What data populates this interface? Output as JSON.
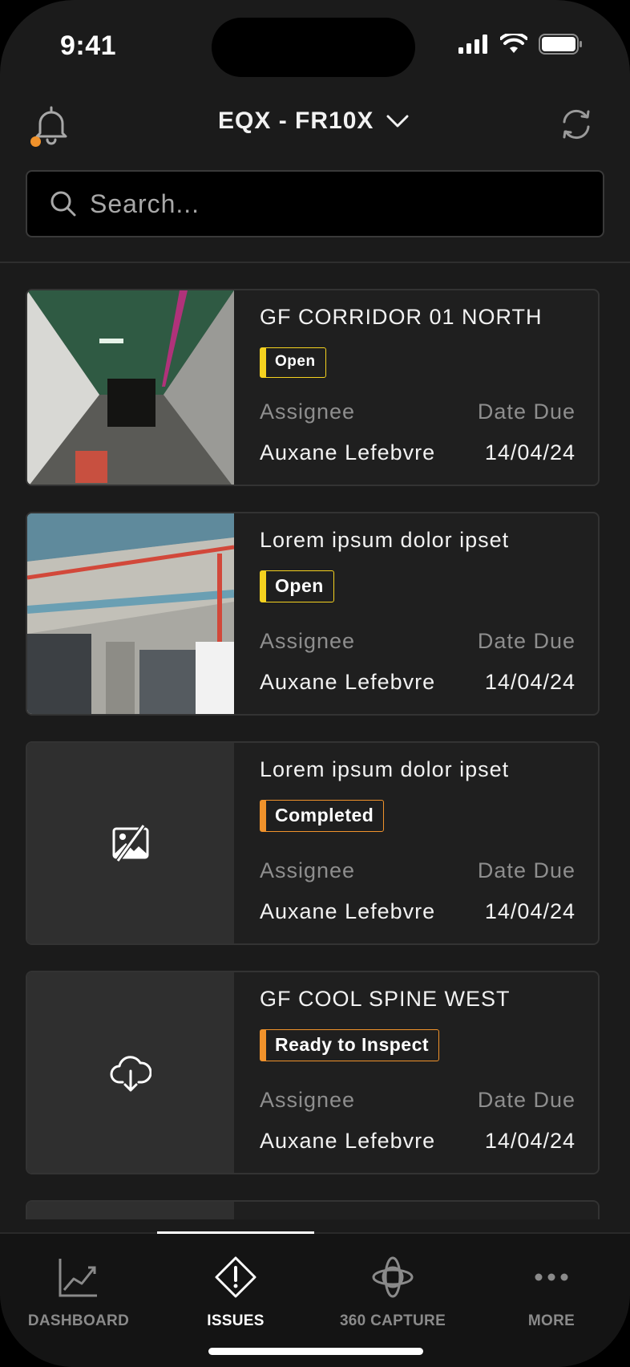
{
  "status_bar": {
    "time": "9:41"
  },
  "header": {
    "project_title": "EQX - FR10X"
  },
  "search": {
    "placeholder": "Search..."
  },
  "issues": [
    {
      "title": "GF CORRIDOR 01 NORTH",
      "status": "Open",
      "assignee_label": "Assignee",
      "assignee": "Auxane Lefebvre",
      "due_label": "Date Due",
      "due": "14/04/24",
      "thumbnail": "photo"
    },
    {
      "title": "Lorem ipsum dolor ipset",
      "status": "Open",
      "assignee_label": "Assignee",
      "assignee": "Auxane Lefebvre",
      "due_label": "Date Due",
      "due": "14/04/24",
      "thumbnail": "photo"
    },
    {
      "title": "Lorem ipsum dolor ipset",
      "status": "Completed",
      "assignee_label": "Assignee",
      "assignee": "Auxane Lefebvre",
      "due_label": "Date Due",
      "due": "14/04/24",
      "thumbnail": "image-unavailable-icon"
    },
    {
      "title": "GF COOL SPINE WEST",
      "status": "Ready to Inspect",
      "assignee_label": "Assignee",
      "assignee": "Auxane Lefebvre",
      "due_label": "Date Due",
      "due": "14/04/24",
      "thumbnail": "cloud-download-icon"
    }
  ],
  "colors": {
    "open": "#f5d21f",
    "completed": "#f0922b",
    "notification": "#f0922b"
  },
  "tabbar": {
    "tabs": [
      {
        "label": "DASHBOARD",
        "icon": "chart-icon"
      },
      {
        "label": "ISSUES",
        "icon": "warning-diamond-icon",
        "active": true
      },
      {
        "label": "360 CAPTURE",
        "icon": "360-capture-icon"
      },
      {
        "label": "MORE",
        "icon": "more-icon"
      }
    ]
  }
}
